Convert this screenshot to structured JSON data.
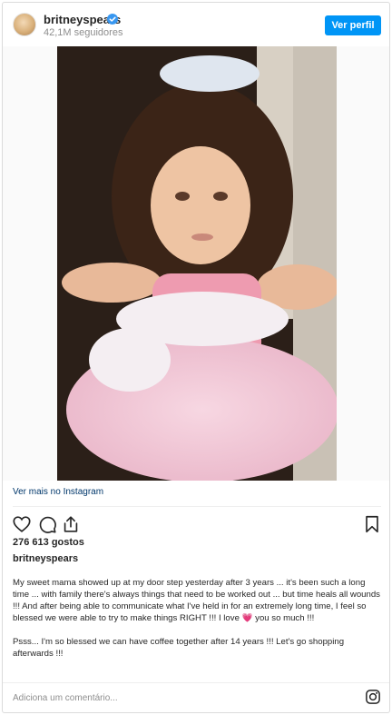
{
  "post": {
    "username": "britneyspears",
    "followers": "42,1M seguidores",
    "view_profile_label": "Ver perfil",
    "view_more_label": "Ver mais no Instagram",
    "likes": "276 613 gostos",
    "caption_username": "britneyspears",
    "caption_paragraphs": [
      "My sweet mama showed up at my door step yesterday after 3 years ... it's been such a long time ... with family there's always things that need to be worked out ... but time heals all wounds !!! And after being able to communicate what I've held in for an extremely long time, I feel so blessed we were able to try to make things RIGHT !!! I love 💗 you so much !!!",
      "Psss... I'm so blessed we can have coffee together after 14 years !!! Let's go shopping afterwards !!!"
    ],
    "comment_placeholder": "Adiciona um comentário...",
    "icons": {
      "verified": "verified-badge-icon",
      "like": "heart-icon",
      "comment": "comment-bubble-icon",
      "share": "share-icon",
      "save": "bookmark-icon",
      "instagram": "instagram-logo-icon"
    },
    "colors": {
      "accent": "#0095f6",
      "link": "#00376b",
      "muted": "#8e8e8e"
    }
  }
}
